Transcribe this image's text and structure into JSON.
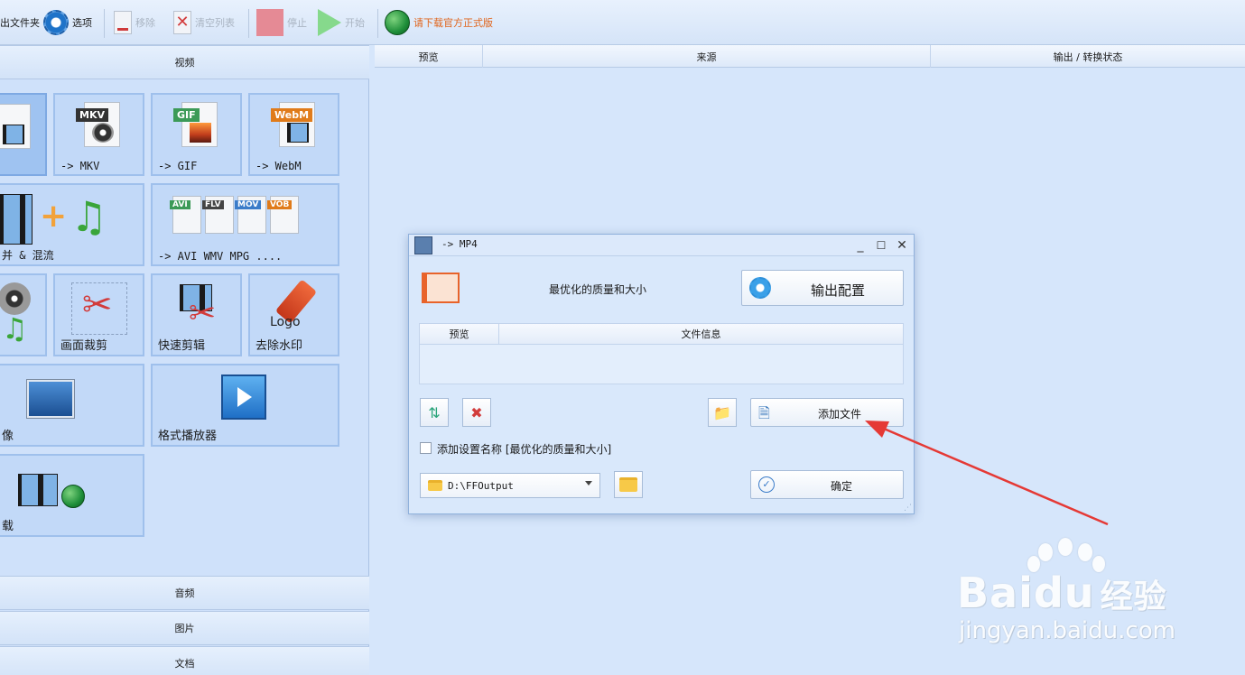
{
  "toolbar": {
    "output_folder": "出文件夹",
    "options": "选项",
    "remove": "移除",
    "clear_list": "清空列表",
    "stop": "停止",
    "start": "开始",
    "download": "请下载官方正式版"
  },
  "left": {
    "video_section": "视频",
    "audio_section": "音频",
    "image_section": "图片",
    "document_section": "文档",
    "tiles": {
      "mkv": "-> MKV",
      "mkv_tag": "MKV",
      "gif": "-> GIF",
      "gif_tag": "GIF",
      "webm": "-> WebM",
      "webm_tag": "WebM",
      "merge": "并 & 混流",
      "multi": "-> AVI WMV MPG ....",
      "avi_tag": "AVI",
      "flv_tag": "FLV",
      "mov_tag": "MOV",
      "vob_tag": "VOB",
      "crop": "画面裁剪",
      "quick_cut": "快速剪辑",
      "remove_logo": "去除水印",
      "logo_text": "Logo",
      "screen": "像",
      "player": "格式播放器",
      "download": "载"
    }
  },
  "list": {
    "col_preview": "预览",
    "col_source": "来源",
    "col_status": "输出 / 转换状态"
  },
  "dialog": {
    "title": "-> MP4",
    "quality": "最优化的质量和大小",
    "output_config": "输出配置",
    "col_preview": "预览",
    "col_fileinfo": "文件信息",
    "add_file": "添加文件",
    "add_setting_name": "添加设置名称 [最优化的质量和大小]",
    "output_path": "D:\\FFOutput",
    "ok": "确定"
  },
  "watermark": {
    "brand": "Bai",
    "brand_du": "du",
    "brand_cn": "经验",
    "url": "jingyan.baidu.com"
  },
  "colors": {
    "accent_orange": "#e0641b",
    "arrow_red": "#e53935",
    "panel_bg": "#cfe1fa"
  }
}
